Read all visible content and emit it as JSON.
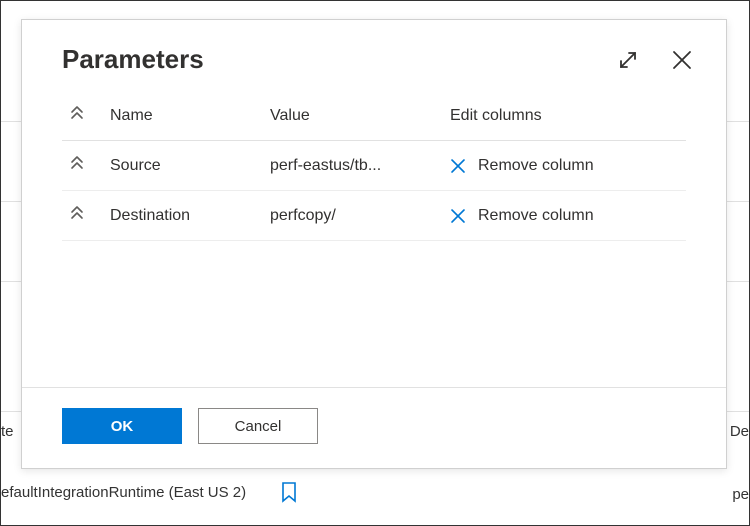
{
  "dialog": {
    "title": "Parameters",
    "columns": {
      "name": "Name",
      "value": "Value",
      "edit": "Edit columns"
    },
    "rows": [
      {
        "name": "Source",
        "value": "perf-eastus/tb...",
        "remove_label": "Remove column"
      },
      {
        "name": "Destination",
        "value": "perfcopy/",
        "remove_label": "Remove column"
      }
    ],
    "footer": {
      "ok_label": "OK",
      "cancel_label": "Cancel"
    }
  },
  "background": {
    "left_truncated": "te",
    "right_truncated": "De",
    "runtime_text": "efaultIntegrationRuntime (East US 2)",
    "right_bottom_truncated": "pe"
  }
}
